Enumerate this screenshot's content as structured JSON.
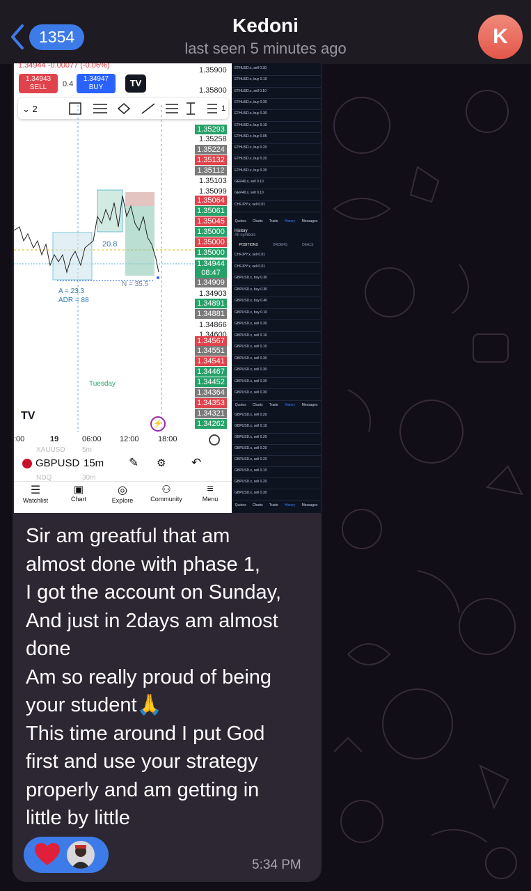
{
  "header": {
    "back_count": "1354",
    "title": "Kedoni",
    "subtitle": "last seen 5 minutes ago",
    "avatar_letter": "K"
  },
  "screenshot": {
    "top_quote": "1.34944 -0.00077 (-0.06%)",
    "sell_price": "1.34943",
    "sell_label": "SELL",
    "spread": "0.4",
    "buy_price": "1.34947",
    "buy_label": "BUY",
    "drawing_count": "2",
    "drawing_count_right": "1",
    "price_scale": [
      "1.35900",
      "1.35800",
      "1.35258",
      "1.35103",
      "1.35099",
      "1.34903",
      "1.34866",
      "1.34600"
    ],
    "price_tags": [
      {
        "v": "1.35293",
        "c": "#26a269"
      },
      {
        "v": "1.35224",
        "c": "#7a7a7a"
      },
      {
        "v": "1.35132",
        "c": "#e0434b"
      },
      {
        "v": "1.35112",
        "c": "#7a7a7a"
      },
      {
        "v": "1.35064",
        "c": "#e0434b"
      },
      {
        "v": "1.35061",
        "c": "#26a269"
      },
      {
        "v": "1.35045",
        "c": "#e0434b"
      },
      {
        "v": "1.35000",
        "c": "#26a269"
      },
      {
        "v": "1.35000",
        "c": "#e0434b"
      },
      {
        "v": "1.35000",
        "c": "#26a269"
      },
      {
        "v": "1.34909",
        "c": "#7a7a7a"
      },
      {
        "v": "1.34891",
        "c": "#26a269"
      },
      {
        "v": "1.34881",
        "c": "#7a7a7a"
      },
      {
        "v": "1.34567",
        "c": "#e0434b"
      },
      {
        "v": "1.34551",
        "c": "#7a7a7a"
      },
      {
        "v": "1.34541",
        "c": "#e0434b"
      },
      {
        "v": "1.34467",
        "c": "#26a269"
      },
      {
        "v": "1.34452",
        "c": "#26a269"
      },
      {
        "v": "1.34364",
        "c": "#7a7a7a"
      },
      {
        "v": "1.34353",
        "c": "#e0434b"
      },
      {
        "v": "1.34321",
        "c": "#7a7a7a"
      },
      {
        "v": "1.34262",
        "c": "#26a269"
      }
    ],
    "current_price": "1.34944",
    "countdown": "08:47",
    "measure_a": "20.8",
    "measure_n": "N = 35.5",
    "range_a": "A = 23.3",
    "range_adr": "ADR = 88",
    "day_label": "Tuesday",
    "time_axis": [
      ":00",
      "19",
      "06:00",
      "12:00",
      "18:00"
    ],
    "symbol_prev": "XAUUSD",
    "symbol_prev_tf": "5m",
    "symbol": "GBPUSD",
    "timeframe": "15m",
    "symbol_next": "NDQ",
    "symbol_next_tf": "30m",
    "nav": [
      "Watchlist",
      "Chart",
      "Explore",
      "Community",
      "Menu"
    ],
    "history_title": "History",
    "history_sub": "All symbols",
    "history_tabs": [
      "POSITIONS",
      "ORDERS",
      "DEALS"
    ],
    "mt_nav": [
      "Quotes",
      "Charts",
      "Trade",
      "History",
      "Messages"
    ],
    "history_rows_top": [
      "ETHUSD.x, sell 0.30",
      "ETHUSD.x, buy 0.10",
      "ETHUSD.x, sell 0.10",
      "ETHUSD.x, buy 0.30",
      "ETHUSD.x, buy 0.30",
      "ETHUSD.x, buy 0.10",
      "ETHUSD.x, buy 0.05",
      "ETHUSD.x, buy 0.20",
      "ETHUSD.x, buy 0.20",
      "ETHUSD.x, buy 0.30",
      "GER40.x, sell 0.10",
      "GER40.x, sell 0.10",
      "CHFJPY.x, sell 0.01"
    ],
    "history_rows_mid": [
      "CHFJPY.x, sell 0.01",
      "CHFJPY.x, sell 0.01",
      "GBPUSD.x, buy 0.30",
      "GBPUSD.x, buy 0.30",
      "GBPUSD.x, buy 0.40",
      "GBPUSD.x, buy 0.10",
      "GBPUSD.x, sell 0.30",
      "GBPUSD.x, sell 0.10",
      "GBPUSD.x, sell 0.10",
      "GBPUSD.x, sell 0.30",
      "GBPUSD.x, sell 0.30",
      "GBPUSD.x, sell 0.30",
      "GBPUSD.x, sell 0.30"
    ],
    "history_rows_bot": [
      "GBPUSD.x, sell 0.20",
      "GBPUSD.x, sell 0.10",
      "GBPUSD.x, sell 0.20",
      "GBPUSD.x, sell 0.20",
      "GBPUSD.x, sell 0.20",
      "GBPUSD.x, sell 0.10",
      "GBPUSD.x, sell 0.20",
      "GBPUSD.x, sell 0.30"
    ]
  },
  "message": {
    "lines": [
      "Sir am greatful that am",
      "almost done with phase 1,",
      "I got the account on Sunday,",
      "And just in 2days am almost",
      "done",
      "Am so really proud of being",
      "your student🙏",
      "This time around I put God",
      "first and use your strategy",
      "properly and am getting in",
      "little by little"
    ],
    "time": "5:34 PM"
  },
  "colors": {
    "accent": "#3d7be8",
    "bubble": "#2d2733",
    "header": "#1f1b22",
    "avatar": "#e4564b",
    "heart": "#e0203a"
  }
}
